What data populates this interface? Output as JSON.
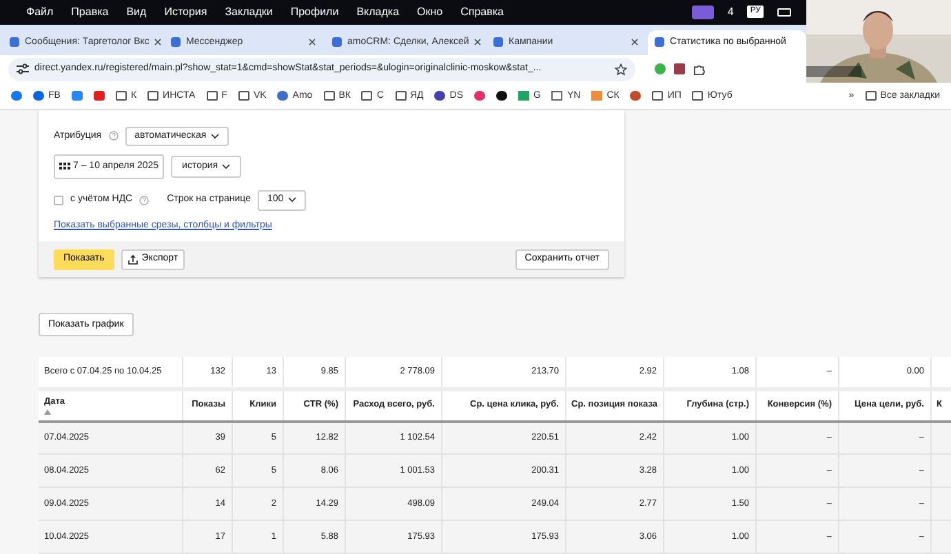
{
  "menu_bar": {
    "items": [
      "Файл",
      "Правка",
      "Вид",
      "История",
      "Закладки",
      "Профили",
      "Вкладка",
      "Окно",
      "Справка"
    ],
    "count": "4",
    "keyboard": "РУ"
  },
  "tabs": [
    {
      "title": "Сообщения: Таргетолог Вкс",
      "selected": false
    },
    {
      "title": "Мессенджер",
      "selected": false
    },
    {
      "title": "amoCRM: Сделки, Алексей",
      "selected": false
    },
    {
      "title": "Кампании",
      "selected": false
    },
    {
      "title": "Статистика по выбранной",
      "selected": true
    }
  ],
  "address_bar": {
    "url": "direct.yandex.ru/registered/main.pl?show_stat=1&cmd=showStat&stat_periods=&ulogin=originalclinic-moskow&stat_..."
  },
  "bookmarks": [
    {
      "kind": "facebook"
    },
    {
      "kind": "meta",
      "label": "FB"
    },
    {
      "kind": "vk"
    },
    {
      "kind": "youtube"
    },
    {
      "kind": "folder",
      "label": "К"
    },
    {
      "kind": "folder",
      "label": "ИНСТА"
    },
    {
      "kind": "folder",
      "label": "F"
    },
    {
      "kind": "folder",
      "label": "VK"
    },
    {
      "kind": "amo",
      "label": "Amo"
    },
    {
      "kind": "folder",
      "label": "ВК"
    },
    {
      "kind": "folder",
      "label": "С"
    },
    {
      "kind": "folder",
      "label": "ЯД"
    },
    {
      "kind": "ring",
      "label": "DS"
    },
    {
      "kind": "instagram"
    },
    {
      "kind": "dark"
    },
    {
      "kind": "drive",
      "label": "G"
    },
    {
      "kind": "square",
      "label": "YN"
    },
    {
      "kind": "doc",
      "label": "СК"
    },
    {
      "kind": "round"
    },
    {
      "kind": "folder",
      "label": "ИП"
    },
    {
      "kind": "folder",
      "label": "Ютуб"
    }
  ],
  "bookmarks_more": "»",
  "all_bookmarks": "Все закладки",
  "filters": {
    "attribution": {
      "label": "Атрибуция",
      "value": "автоматическая"
    },
    "period": "7 – 10 апреля 2025",
    "history": "история",
    "vat": {
      "label": "с учётом НДС",
      "checked": false
    },
    "rows_per_page": {
      "label": "Строк на странице",
      "value": "100"
    },
    "link": "Показать выбранные срезы, столбцы и фильтры"
  },
  "actions": {
    "show": "Показать",
    "export": "Экспорт",
    "save": "Сохранить отчет"
  },
  "show_chart": "Показать график",
  "table": {
    "totals": [
      "Всего с 07.04.25 по 10.04.25",
      "132",
      "13",
      "9.85",
      "2 778.09",
      "213.70",
      "2.92",
      "1.08",
      "–",
      "0.00"
    ],
    "columns": [
      {
        "label": "Дата",
        "sorted": true
      },
      {
        "label": "Показы",
        "sorted": false
      },
      {
        "label": "Клики",
        "sorted": false
      },
      {
        "label": "CTR (%)",
        "sorted": false
      },
      {
        "label": "Расход всего, руб.",
        "sorted": false
      },
      {
        "label": "Ср. цена клика, руб.",
        "sorted": false
      },
      {
        "label": "Ср. позиция показа",
        "sorted": false
      },
      {
        "label": "Глубина (стр.)",
        "sorted": false
      },
      {
        "label": "Конверсия (%)",
        "sorted": false
      },
      {
        "label": "Цена цели, руб.",
        "sorted": false
      },
      {
        "label": "К",
        "sorted": false
      }
    ],
    "rows": [
      [
        "07.04.2025",
        "39",
        "5",
        "12.82",
        "1 102.54",
        "220.51",
        "2.42",
        "1.00",
        "–",
        "–"
      ],
      [
        "08.04.2025",
        "62",
        "5",
        "8.06",
        "1 001.53",
        "200.31",
        "3.28",
        "1.00",
        "–",
        "–"
      ],
      [
        "09.04.2025",
        "14",
        "2",
        "14.29",
        "498.09",
        "249.04",
        "2.77",
        "1.50",
        "–",
        "–"
      ],
      [
        "10.04.2025",
        "17",
        "1",
        "5.88",
        "175.93",
        "175.93",
        "3.06",
        "1.00",
        "–",
        "–"
      ]
    ]
  }
}
